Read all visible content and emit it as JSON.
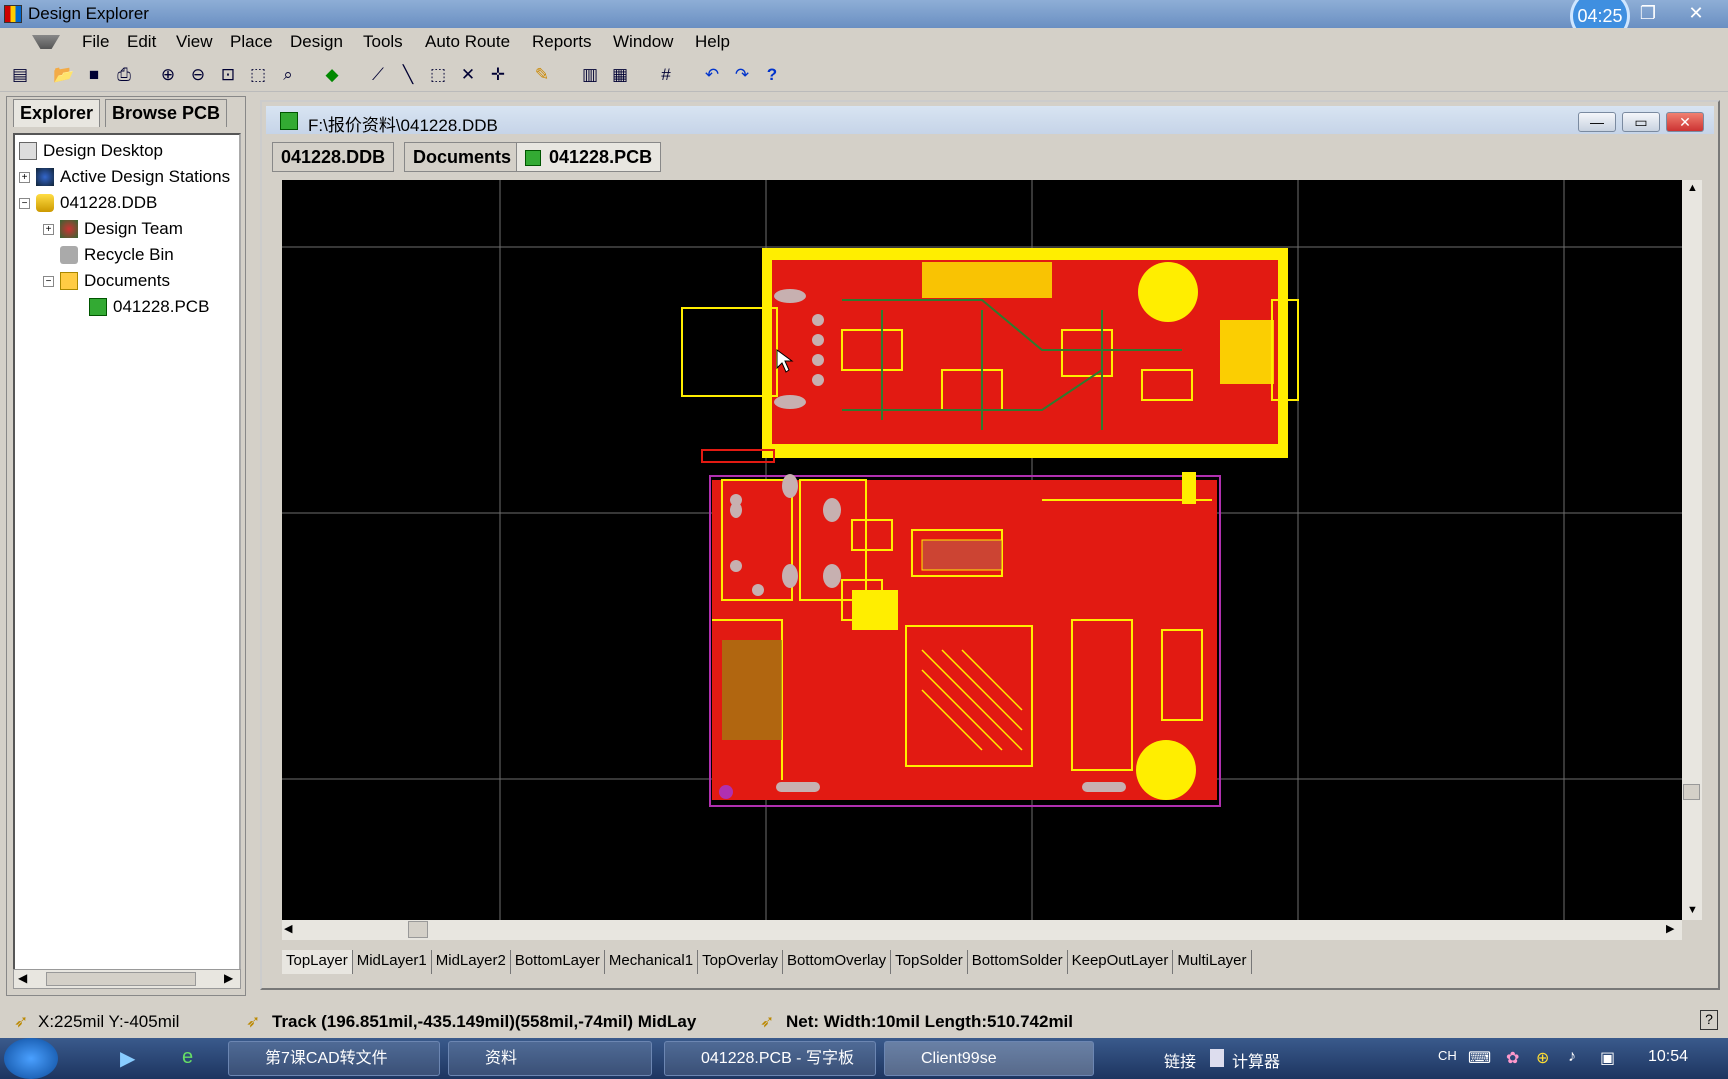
{
  "window": {
    "title": "Design Explorer",
    "time_badge": "04:25"
  },
  "menu": [
    "File",
    "Edit",
    "View",
    "Place",
    "Design",
    "Tools",
    "Auto Route",
    "Reports",
    "Window",
    "Help"
  ],
  "panel": {
    "tabs": [
      "Explorer",
      "Browse PCB"
    ],
    "tree": [
      {
        "label": "Design Desktop"
      },
      {
        "label": "Active Design Stations"
      },
      {
        "label": "041228.DDB"
      },
      {
        "label": "Design Team"
      },
      {
        "label": "Recycle Bin"
      },
      {
        "label": "Documents"
      },
      {
        "label": "041228.PCB"
      }
    ]
  },
  "doc": {
    "title": "F:\\报价资料\\041228.DDB",
    "tabs": [
      "041228.DDB",
      "Documents",
      "041228.PCB"
    ],
    "layers": [
      "TopLayer",
      "MidLayer1",
      "MidLayer2",
      "BottomLayer",
      "Mechanical1",
      "TopOverlay",
      "BottomOverlay",
      "TopSolder",
      "BottomSolder",
      "KeepOutLayer",
      "MultiLayer"
    ]
  },
  "status": {
    "coords": "X:225mil Y:-405mil",
    "track": "Track (196.851mil,-435.149mil)(558mil,-74mil)  MidLay",
    "net": "Net: Width:10mil Length:510.742mil"
  },
  "taskbar": {
    "tasks": [
      "第7课CAD转文件",
      "资料",
      "041228.PCB - 写字板",
      "Client99se"
    ],
    "tray_links": "链接",
    "tray_calc": "计算器",
    "lang": "CH",
    "clock": "10:54"
  },
  "colors": {
    "copper": "#e21a12",
    "silk": "#ffee00",
    "board_bg": "#000000",
    "grid": "#6e6e6e"
  }
}
